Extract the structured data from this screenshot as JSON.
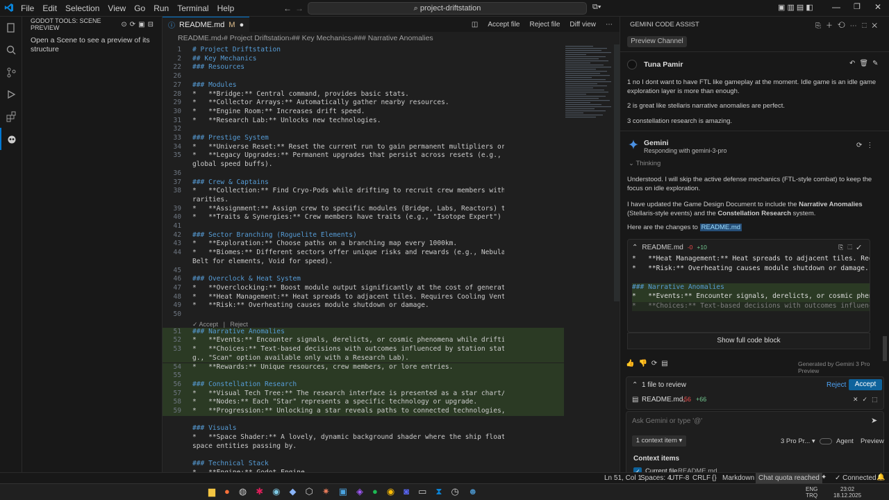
{
  "titlebar": {
    "menu": [
      "File",
      "Edit",
      "Selection",
      "View",
      "Go",
      "Run",
      "Terminal",
      "Help"
    ],
    "search": "project-driftstation"
  },
  "sidebar": {
    "title": "GODOT TOOLS: SCENE PREVIEW",
    "message": "Open a Scene to see a preview of its structure"
  },
  "editor": {
    "tab_label": "README.md",
    "tab_mod": "M",
    "actions": {
      "accept": "Accept file",
      "reject": "Reject file",
      "diff": "Diff view"
    },
    "breadcrumb": [
      "README.md",
      "# Project Driftstation",
      "## Key Mechanics",
      "### Narrative Anomalies"
    ],
    "inline_accept": "Accept",
    "inline_reject": "Reject",
    "lines": [
      {
        "n": "1",
        "t": "# Project Driftstation",
        "k": "h"
      },
      {
        "n": "2",
        "t": "## Key Mechanics",
        "k": "h"
      },
      {
        "n": "22",
        "t": "### Resources",
        "k": "h"
      },
      {
        "n": "26",
        "t": "",
        "k": ""
      },
      {
        "n": "27",
        "t": "### Modules",
        "k": "h"
      },
      {
        "n": "28",
        "t": "*   **Bridge:** Central command, provides basic stats.",
        "k": ""
      },
      {
        "n": "29",
        "t": "*   **Collector Arrays:** Automatically gather nearby resources.",
        "k": ""
      },
      {
        "n": "30",
        "t": "*   **Engine Room:** Increases drift speed.",
        "k": ""
      },
      {
        "n": "31",
        "t": "*   **Research Lab:** Unlocks new technologies.",
        "k": ""
      },
      {
        "n": "32",
        "t": "",
        "k": ""
      },
      {
        "n": "33",
        "t": "### Prestige System",
        "k": "h"
      },
      {
        "n": "34",
        "t": "*   **Universe Reset:** Reset the current run to gain permanent multipliers or currency.",
        "k": ""
      },
      {
        "n": "35",
        "t": "*   **Legacy Upgrades:** Permanent upgrades that persist across resets (e.g., starting resources,",
        "k": ""
      },
      {
        "n": "",
        "t": "global speed buffs).",
        "k": ""
      },
      {
        "n": "36",
        "t": "",
        "k": ""
      },
      {
        "n": "37",
        "t": "### Crew & Captains",
        "k": "h"
      },
      {
        "n": "38",
        "t": "*   **Collection:** Find Cryo-Pods while drifting to recruit crew members with randomized stats and",
        "k": ""
      },
      {
        "n": "",
        "t": "rarities.",
        "k": ""
      },
      {
        "n": "39",
        "t": "*   **Assignment:** Assign crew to specific modules (Bridge, Labs, Reactors) to boost performance.",
        "k": ""
      },
      {
        "n": "40",
        "t": "*   **Traits & Synergies:** Crew members have traits (e.g., \"Isotope Expert\") and faction synergies.",
        "k": ""
      },
      {
        "n": "41",
        "t": "",
        "k": ""
      },
      {
        "n": "42",
        "t": "### Sector Branching (Roguelite Elements)",
        "k": "h"
      },
      {
        "n": "43",
        "t": "*   **Exploration:** Choose paths on a branching map every 1000km.",
        "k": ""
      },
      {
        "n": "44",
        "t": "*   **Biomes:** Different sectors offer unique risks and rewards (e.g., Nebula for energy, Asteroid",
        "k": ""
      },
      {
        "n": "",
        "t": "Belt for elements, Void for speed).",
        "k": ""
      },
      {
        "n": "45",
        "t": "",
        "k": ""
      },
      {
        "n": "46",
        "t": "### Overclock & Heat System",
        "k": "h"
      },
      {
        "n": "47",
        "t": "*   **Overclocking:** Boost module output significantly at the cost of generating Heat.",
        "k": ""
      },
      {
        "n": "48",
        "t": "*   **Heat Management:** Heat spreads to adjacent tiles. Requires Cooling Vents to dissipate.",
        "k": ""
      },
      {
        "n": "49",
        "t": "*   **Risk:** Overheating causes module shutdown or damage.",
        "k": ""
      },
      {
        "n": "50",
        "t": "",
        "k": ""
      }
    ],
    "added": [
      {
        "n": "51",
        "t": "### Narrative Anomalies",
        "k": "h"
      },
      {
        "n": "52",
        "t": "*   **Events:** Encounter signals, derelicts, or cosmic phenomena while drifting.",
        "k": ""
      },
      {
        "n": "53",
        "t": "*   **Choices:** Text-based decisions with outcomes influenced by station stats, modules, or crew (e.",
        "k": ""
      },
      {
        "n": "",
        "t": "g., \"Scan\" option available only with a Research Lab).",
        "k": ""
      },
      {
        "n": "54",
        "t": "*   **Rewards:** Unique resources, crew members, or lore entries.",
        "k": ""
      },
      {
        "n": "55",
        "t": "",
        "k": ""
      },
      {
        "n": "56",
        "t": "### Constellation Research",
        "k": "h"
      },
      {
        "n": "57",
        "t": "*   **Visual Tech Tree:** The research interface is presented as a star chart/constellation map.",
        "k": ""
      },
      {
        "n": "58",
        "t": "*   **Nodes:** Each \"Star\" represents a specific technology or upgrade.",
        "k": ""
      },
      {
        "n": "59",
        "t": "*   **Progression:** Unlocking a star reveals paths to connected technologies, simulating exploration.",
        "k": ""
      }
    ],
    "after": [
      {
        "n": "",
        "t": "",
        "k": ""
      },
      {
        "n": "",
        "t": "### Visuals",
        "k": "h"
      },
      {
        "n": "",
        "t": "*   **Space Shader:** A lovely, dynamic background shader where the ship floats, with stars and other",
        "k": ""
      },
      {
        "n": "",
        "t": "space entities passing by.",
        "k": ""
      },
      {
        "n": "",
        "t": "",
        "k": ""
      },
      {
        "n": "",
        "t": "### Technical Stack",
        "k": "h"
      },
      {
        "n": "",
        "t": "*   **Engine:** Godot Engine",
        "k": ""
      }
    ]
  },
  "chat": {
    "header": "GEMINI CODE ASSIST",
    "preview_channel": "Preview Channel",
    "user_name": "Tuna Pamir",
    "user_msgs": [
      "1 no I dont want to have FTL like gameplay at the moment. Idle game is an idle game exploration layer is more than enough.",
      "2 is great like stellaris narrative anomalies are perfect.",
      "3 constellation research is amazing."
    ],
    "bot_name": "Gemini",
    "bot_sub": "Responding with gemini-3-pro",
    "thinking": "Thinking",
    "resp1": "Understood. I will skip the active defense mechanics (FTL-style combat) to keep the focus on idle exploration.",
    "resp2a": "I have updated the Game Design Document to include the ",
    "resp2b": "Narrative Anomalies",
    "resp2c": " (Stellaris-style events) and the ",
    "resp2d": "Constellation Research",
    "resp2e": " system.",
    "resp3": "Here are the changes to ",
    "resp3_link": "README.md",
    "code_file": "README.md",
    "code_del": "-0",
    "code_add": "+10",
    "code_lines": [
      {
        "t": "*   **Heat Management:** Heat spreads to adjacent tiles. Requires C",
        "k": ""
      },
      {
        "t": "*   **Risk:** Overheating causes module shutdown or damage.",
        "k": ""
      },
      {
        "t": "",
        "k": ""
      },
      {
        "t": "### Narrative Anomalies",
        "k": "h"
      },
      {
        "t": "*   **Events:** Encounter signals, derelicts, or cosmic phenomena w",
        "k": ""
      },
      {
        "t": "*   **Choices:** Text-based decisions with outcomes influenced by s",
        "k": ""
      }
    ],
    "show_full": "Show full code block",
    "generated": "Generated by Gemini 3 Pro Preview",
    "review_title": "1 file to review",
    "reject": "Reject",
    "accept": "Accept",
    "file_row": "README.md,",
    "file_del": "-56",
    "file_add": "+66",
    "input_placeholder": "Ask Gemini or type '@'",
    "context_btn": "1 context item",
    "model": "3 Pro Pr...",
    "agent": "Agent",
    "preview": "Preview",
    "context_title": "Context items",
    "current_file": "Current file",
    "current_file_name": "README.md"
  },
  "status": {
    "pos": "Ln 51, Col 1",
    "spaces": "Spaces: 4",
    "enc": "UTF-8",
    "eol": "CRLF",
    "lang": "Markdown",
    "quota": "Chat quota reached",
    "conn": "Connected"
  },
  "taskbar": {
    "lang1": "ENG",
    "lang2": "TRQ",
    "time": "23:02",
    "date": "18.12.2025"
  },
  "colors": {
    "accent": "#0078d4",
    "added_bg": "#2b3a24",
    "heading": "#569cd6",
    "bold": "#ce9178"
  }
}
